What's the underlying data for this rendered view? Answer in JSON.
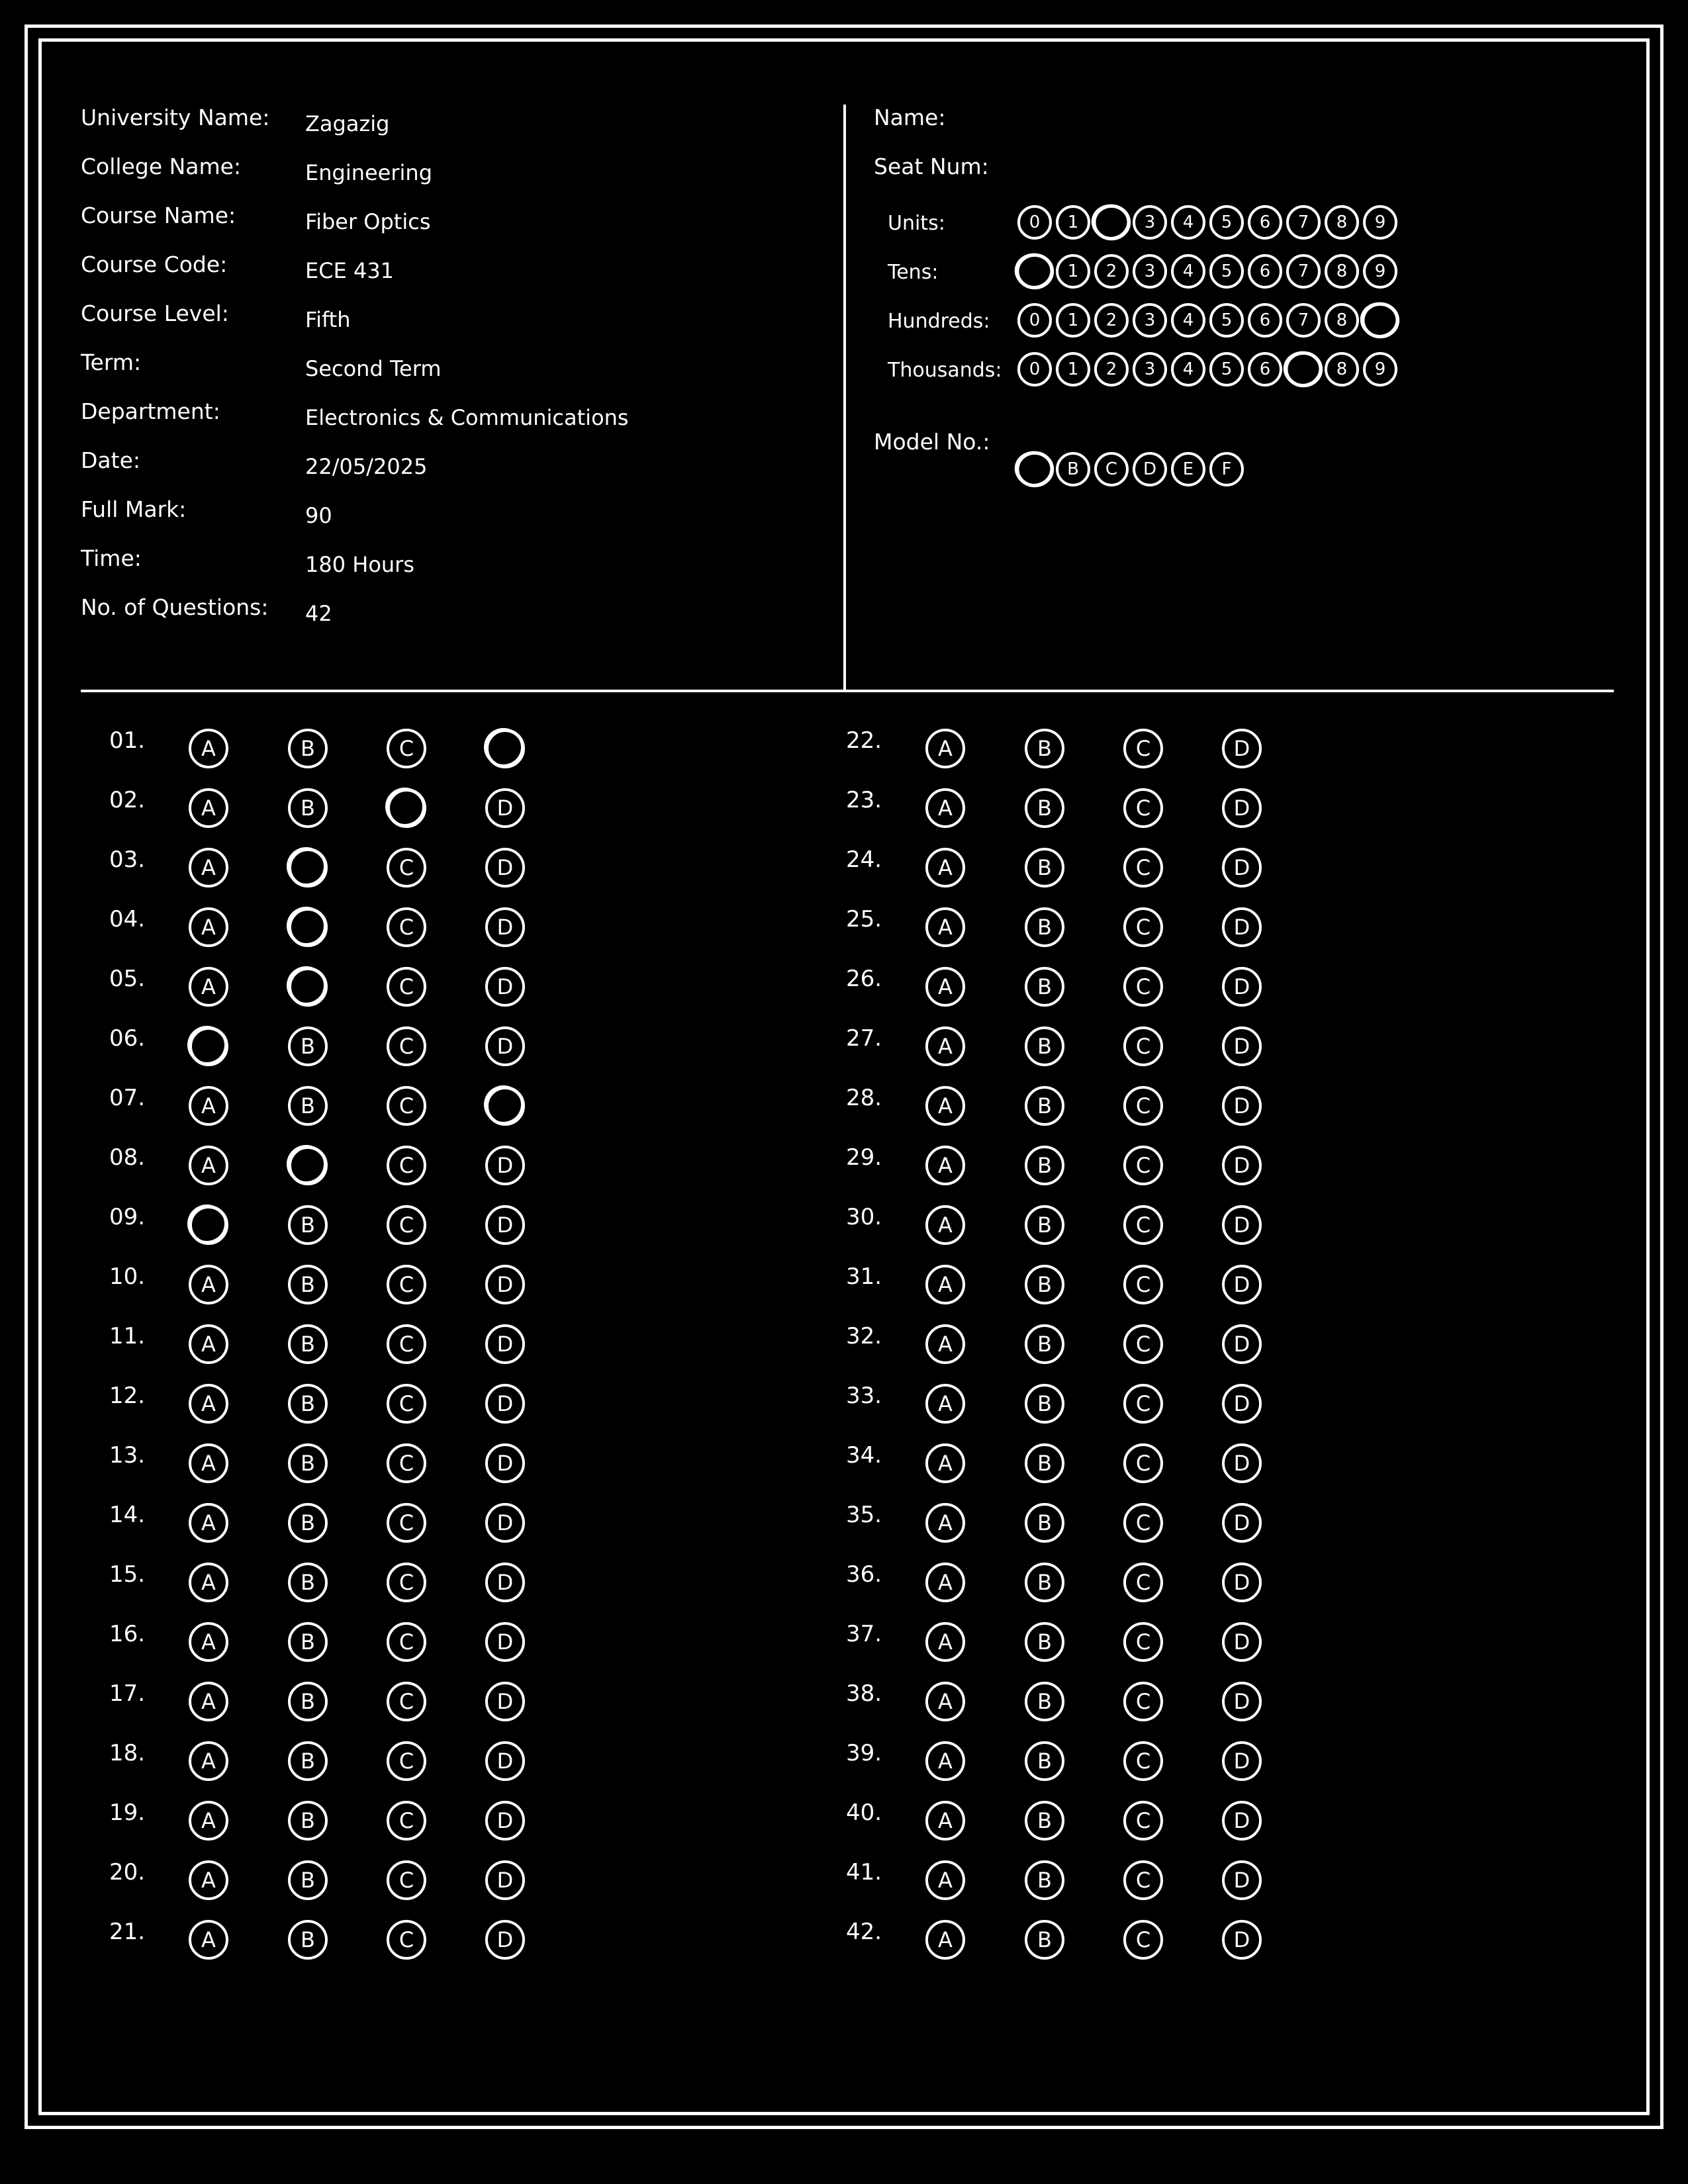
{
  "header": {
    "fields": [
      {
        "label": "University Name:",
        "value": "Zagazig"
      },
      {
        "label": "College Name:",
        "value": "Engineering"
      },
      {
        "label": "Course Name:",
        "value": "Fiber Optics"
      },
      {
        "label": "Course Code:",
        "value": "ECE 431"
      },
      {
        "label": "Course Level:",
        "value": "Fifth"
      },
      {
        "label": "Term:",
        "value": "Second Term"
      },
      {
        "label": "Department:",
        "value": "Electronics & Communications"
      },
      {
        "label": "Date:",
        "value": "22/05/2025"
      },
      {
        "label": "Full Mark:",
        "value": "90"
      },
      {
        "label": "Time:",
        "value": "180 Hours"
      },
      {
        "label": "No. of Questions:",
        "value": "42"
      }
    ]
  },
  "student": {
    "name_label": "Name:",
    "seat_label": "Seat Num:",
    "digit_options": [
      "0",
      "1",
      "2",
      "3",
      "4",
      "5",
      "6",
      "7",
      "8",
      "9"
    ],
    "seat_digits": [
      {
        "label": "Units:",
        "selected": 2
      },
      {
        "label": "Tens:",
        "selected": 0
      },
      {
        "label": "Hundreds:",
        "selected": 9
      },
      {
        "label": "Thousands:",
        "selected": 7
      }
    ],
    "model_label": "Model No.:",
    "model_options": [
      "A",
      "B",
      "C",
      "D",
      "E",
      "F"
    ],
    "model_selected": 0
  },
  "answers": {
    "options": [
      "A",
      "B",
      "C",
      "D"
    ],
    "questions": [
      {
        "num": "01.",
        "selected": 3
      },
      {
        "num": "02.",
        "selected": 2
      },
      {
        "num": "03.",
        "selected": 1
      },
      {
        "num": "04.",
        "selected": 1
      },
      {
        "num": "05.",
        "selected": 1
      },
      {
        "num": "06.",
        "selected": 0
      },
      {
        "num": "07.",
        "selected": 3
      },
      {
        "num": "08.",
        "selected": 1
      },
      {
        "num": "09.",
        "selected": 0
      },
      {
        "num": "10.",
        "selected": null
      },
      {
        "num": "11.",
        "selected": null
      },
      {
        "num": "12.",
        "selected": null
      },
      {
        "num": "13.",
        "selected": null
      },
      {
        "num": "14.",
        "selected": null
      },
      {
        "num": "15.",
        "selected": null
      },
      {
        "num": "16.",
        "selected": null
      },
      {
        "num": "17.",
        "selected": null
      },
      {
        "num": "18.",
        "selected": null
      },
      {
        "num": "19.",
        "selected": null
      },
      {
        "num": "20.",
        "selected": null
      },
      {
        "num": "21.",
        "selected": null
      },
      {
        "num": "22.",
        "selected": null
      },
      {
        "num": "23.",
        "selected": null
      },
      {
        "num": "24.",
        "selected": null
      },
      {
        "num": "25.",
        "selected": null
      },
      {
        "num": "26.",
        "selected": null
      },
      {
        "num": "27.",
        "selected": null
      },
      {
        "num": "28.",
        "selected": null
      },
      {
        "num": "29.",
        "selected": null
      },
      {
        "num": "30.",
        "selected": null
      },
      {
        "num": "31.",
        "selected": null
      },
      {
        "num": "32.",
        "selected": null
      },
      {
        "num": "33.",
        "selected": null
      },
      {
        "num": "34.",
        "selected": null
      },
      {
        "num": "35.",
        "selected": null
      },
      {
        "num": "36.",
        "selected": null
      },
      {
        "num": "37.",
        "selected": null
      },
      {
        "num": "38.",
        "selected": null
      },
      {
        "num": "39.",
        "selected": null
      },
      {
        "num": "40.",
        "selected": null
      },
      {
        "num": "41.",
        "selected": null
      },
      {
        "num": "42.",
        "selected": null
      }
    ]
  }
}
